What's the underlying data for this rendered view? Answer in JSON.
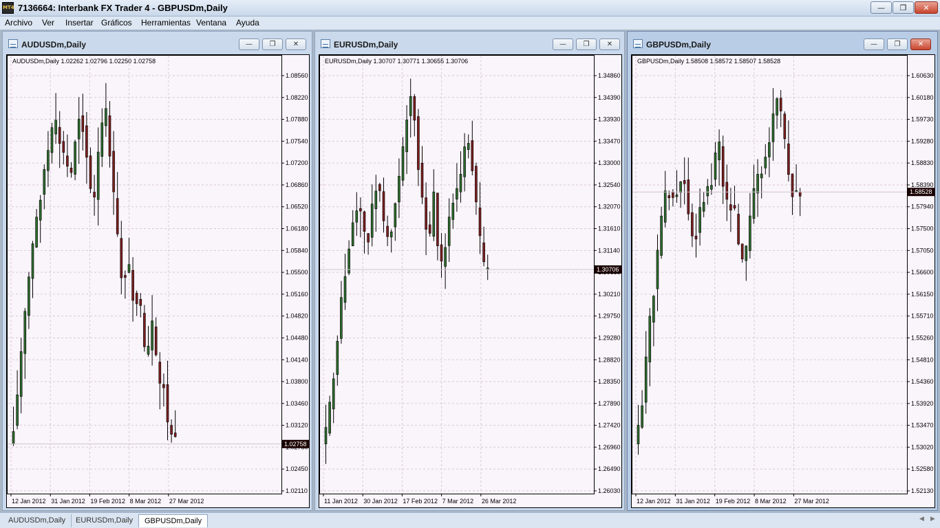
{
  "app": {
    "title": "7136664: Interbank FX Trader 4 - GBPUSDm,Daily",
    "icon": "metatrader-app-icon",
    "icon_text": "MT4"
  },
  "window_controls": {
    "minimize": "—",
    "maximize": "❐",
    "close": "✕"
  },
  "menu": [
    "Archivo",
    "Ver",
    "Insertar",
    "Gráficos",
    "Herramientas",
    "Ventana",
    "Ayuda"
  ],
  "charts": [
    {
      "title": "AUDUSDm,Daily",
      "info": "AUDUSDm,Daily  1.02262 1.02796 1.02250 1.02758",
      "price_labels": [
        "1.08560",
        "1.08220",
        "1.07880",
        "1.07540",
        "1.07200",
        "1.06860",
        "1.06520",
        "1.06180",
        "1.05840",
        "1.05500",
        "1.05160",
        "1.04820",
        "1.04480",
        "1.04140",
        "1.03800",
        "1.03460",
        "1.03120",
        "1.02780",
        "1.02450",
        "1.02110"
      ],
      "current_price": "1.02758",
      "date_labels": [
        "12 Jan 2012",
        "31 Jan 2012",
        "19 Feb 2012",
        "8 Mar 2012",
        "27 Mar 2012"
      ]
    },
    {
      "title": "EURUSDm,Daily",
      "info": "EURUSDm,Daily  1.30707 1.30771 1.30655 1.30706",
      "price_labels": [
        "1.34860",
        "1.34390",
        "1.33930",
        "1.33470",
        "1.33000",
        "1.32540",
        "1.32070",
        "1.31610",
        "1.31140",
        "1.30680",
        "1.30210",
        "1.29750",
        "1.29280",
        "1.28820",
        "1.28350",
        "1.27890",
        "1.27420",
        "1.26960",
        "1.26490",
        "1.26030"
      ],
      "current_price": "1.30706",
      "date_labels": [
        "11 Jan 2012",
        "30 Jan 2012",
        "17 Feb 2012",
        "7 Mar 2012",
        "26 Mar 2012"
      ]
    },
    {
      "title": "GBPUSDm,Daily",
      "info": "GBPUSDm,Daily  1.58508 1.58572 1.58507 1.58528",
      "price_labels": [
        "1.60630",
        "1.60180",
        "1.59730",
        "1.59280",
        "1.58830",
        "1.58390",
        "1.57940",
        "1.57500",
        "1.57050",
        "1.56600",
        "1.56150",
        "1.55710",
        "1.55260",
        "1.54810",
        "1.54360",
        "1.53920",
        "1.53470",
        "1.53020",
        "1.52580",
        "1.52130"
      ],
      "current_price": "1.58528",
      "date_labels": [
        "12 Jan 2012",
        "31 Jan 2012",
        "19 Feb 2012",
        "8 Mar 2012",
        "27 Mar 2012"
      ]
    }
  ],
  "tabs": [
    "AUDUSDm,Daily",
    "EURUSDm,Daily",
    "GBPUSDm,Daily"
  ],
  "active_tab": "GBPUSDm,Daily",
  "colors": {
    "chart_bg": "#faf4fb",
    "bull_candle": "#2e6b2e",
    "bear_candle": "#7a1f1f",
    "grid": "#d9c9d9",
    "price_tag_bg": "#1a0000"
  }
}
